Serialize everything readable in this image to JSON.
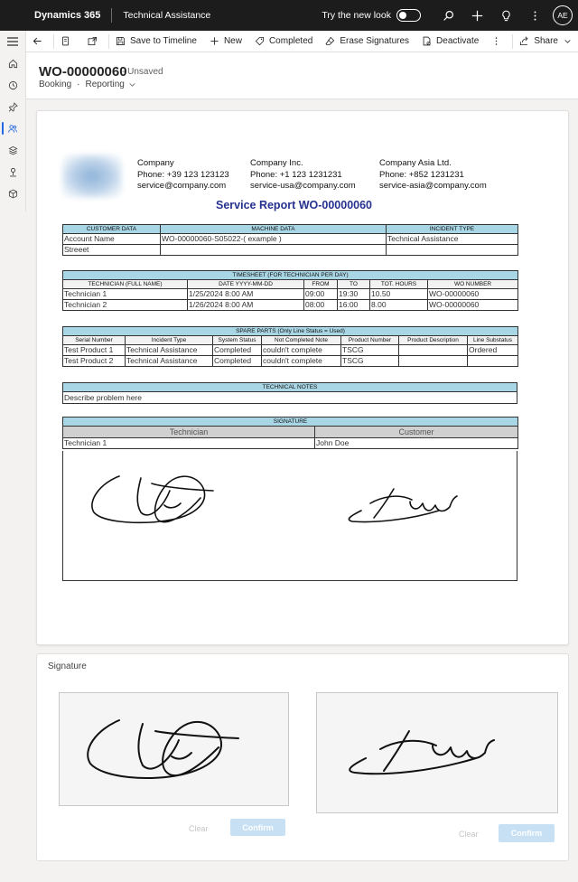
{
  "topbar": {
    "app_name": "Dynamics 365",
    "area_name": "Technical Assistance",
    "try_new_look": "Try the new look",
    "avatar_initials": "AE"
  },
  "commands": {
    "save_to_timeline": "Save to Timeline",
    "new": "New",
    "completed": "Completed",
    "erase_signatures": "Erase Signatures",
    "deactivate": "Deactivate",
    "share": "Share"
  },
  "record": {
    "title": "WO-00000060",
    "state": "- Unsaved",
    "entity": "Booking",
    "form": "Reporting"
  },
  "report": {
    "title": "Service Report WO-00000060",
    "companies": [
      {
        "name": "Company",
        "phone": "Phone: +39 123 123123",
        "email": "service@company.com"
      },
      {
        "name": "Company Inc.",
        "phone": "Phone: +1 123 1231231",
        "email": "service-usa@company.com"
      },
      {
        "name": "Company Asia Ltd.",
        "phone": "Phone: +852 1231231",
        "email": "service-asia@company.com"
      }
    ],
    "customer": {
      "h_customer": "CUSTOMER DATA",
      "h_machine": "MACHINE DATA",
      "h_incident": "INCIDENT TYPE",
      "account_name": "Account Name",
      "machine": "WO-00000060-S05022-( example )",
      "incident": "Technical Assistance",
      "street": "Streeet"
    },
    "timesheet": {
      "header": "TIMESHEET (FOR TECHNICIAN PER DAY)",
      "cols": [
        "TECHNICIAN (FULL NAME)",
        "DATE YYYY-MM-DD",
        "FROM",
        "TO",
        "TOT. HOURS",
        "WO NUMBER"
      ],
      "rows": [
        [
          "Technician 1",
          "1/25/2024 8:00 AM",
          "09:00",
          "19:30",
          "10.50",
          "WO-00000060"
        ],
        [
          "Technician 2",
          "1/26/2024 8:00 AM",
          "08:00",
          "16:00",
          "8.00",
          "WO-00000060"
        ]
      ]
    },
    "spare_parts": {
      "header": "SPARE PARTS (Only Line Status = Used)",
      "cols": [
        "Serial Number",
        "Incident Type",
        "System Status",
        "Not Completed Note",
        "Product Number",
        "Product Description",
        "Line Substatus"
      ],
      "rows": [
        [
          "Test Product 1",
          "Technical Assistance",
          "Completed",
          "couldn't complete",
          "TSCG",
          "",
          "Ordered"
        ],
        [
          "Test Product 2",
          "Technical Assistance",
          "Completed",
          "couldn't complete",
          "TSCG",
          "",
          ""
        ]
      ]
    },
    "notes": {
      "header": "TECHNICAL NOTES",
      "text": "Describe problem here"
    },
    "signature": {
      "header": "SIGNATURE",
      "technician_label": "Technician",
      "customer_label": "Customer",
      "technician_name": "Technician 1",
      "customer_name": "John Doe"
    }
  },
  "signature_card": {
    "label": "Signature",
    "clear": "Clear",
    "confirm": "Confirm"
  },
  "colors": {
    "topbar": "#1c1c1c",
    "report_title": "#25318f",
    "table_header": "#a9d6e5",
    "confirm_disabled": "#c7e0f4",
    "accent": "#2266e3"
  }
}
